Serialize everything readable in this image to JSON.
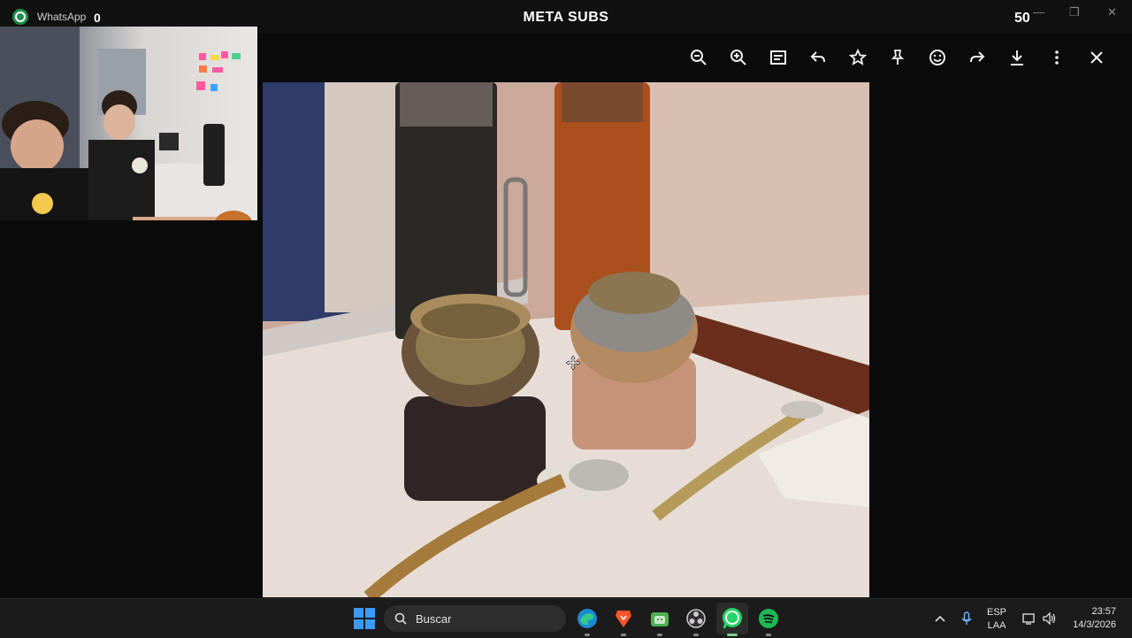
{
  "titlebar": {
    "app_name": "WhatsApp",
    "left_counter": "0",
    "channel": "META SUBS",
    "right_counter": "50",
    "minimize": "—",
    "maximize": "❐",
    "close": "✕"
  },
  "viewer_toolbar": {
    "icons": [
      "zoom-out-icon",
      "zoom-in-icon",
      "caption-icon",
      "reply-icon",
      "star-icon",
      "pin-icon",
      "emoji-icon",
      "forward-icon",
      "download-icon",
      "more-icon",
      "close-icon"
    ]
  },
  "taskbar": {
    "search_placeholder": "Buscar",
    "apps": [
      "edge",
      "brave",
      "android-studio",
      "obs",
      "whatsapp",
      "spotify"
    ],
    "lang_line1": "ESP",
    "lang_line2": "LAA",
    "time": "23:57",
    "date": "14/3/2026"
  },
  "colors": {
    "accent_green": "#1f8f4a",
    "windows_blue": "#3a9bff",
    "spotify_green": "#1db954"
  }
}
